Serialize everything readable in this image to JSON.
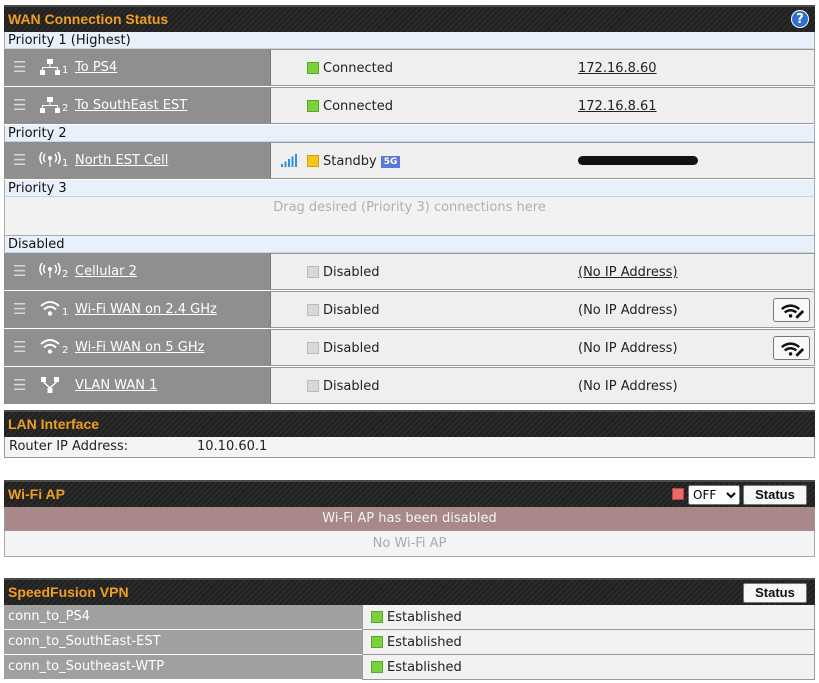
{
  "wan": {
    "title": "WAN Connection Status",
    "help_icon": "help-icon",
    "priority1": "Priority 1 (Highest)",
    "priority2": "Priority 2",
    "priority3": "Priority 3",
    "disabled": "Disabled",
    "drag_hint": "Drag desired (Priority 3) connections here",
    "rows": [
      {
        "index": "1",
        "name": "To PS4",
        "status": "Connected",
        "ip": "172.16.8.60",
        "icon": "ethernet-icon",
        "status_color": "#7ad23a"
      },
      {
        "index": "2",
        "name": "To SouthEast EST",
        "status": "Connected",
        "ip": "172.16.8.61",
        "icon": "ethernet-icon",
        "status_color": "#7ad23a"
      },
      {
        "index": "1",
        "name": "North EST Cell",
        "status": "Standby",
        "badge": "5G",
        "icon": "cellular-icon",
        "status_color": "#f5c518"
      },
      {
        "index": "2",
        "name": "Cellular 2",
        "status": "Disabled",
        "ip": "(No IP Address)",
        "icon": "cellular-icon"
      },
      {
        "index": "1",
        "name": "Wi-Fi WAN on 2.4 GHz",
        "status": "Disabled",
        "ip": "(No IP Address)",
        "icon": "wifi-icon"
      },
      {
        "index": "2",
        "name": "Wi-Fi WAN on 5 GHz",
        "status": "Disabled",
        "ip": "(No IP Address)",
        "icon": "wifi-icon"
      },
      {
        "index": "",
        "name": "VLAN WAN 1",
        "status": "Disabled",
        "ip": "(No IP Address)",
        "icon": "vlan-icon"
      }
    ]
  },
  "lan": {
    "title": "LAN Interface",
    "router_ip_label": "Router IP Address:",
    "router_ip": "10.10.60.1"
  },
  "wifi_ap": {
    "title": "Wi-Fi AP",
    "toggle_value": "OFF",
    "status_button": "Status",
    "message": "Wi-Fi AP has been disabled",
    "empty": "No Wi-Fi AP"
  },
  "vpn": {
    "title": "SpeedFusion VPN",
    "status_button": "Status",
    "rows": [
      {
        "name": "conn_to_PS4",
        "status": "Established"
      },
      {
        "name": "conn_to_SouthEast-EST",
        "status": "Established"
      },
      {
        "name": "conn_to_Southeast-WTP",
        "status": "Established"
      }
    ]
  }
}
